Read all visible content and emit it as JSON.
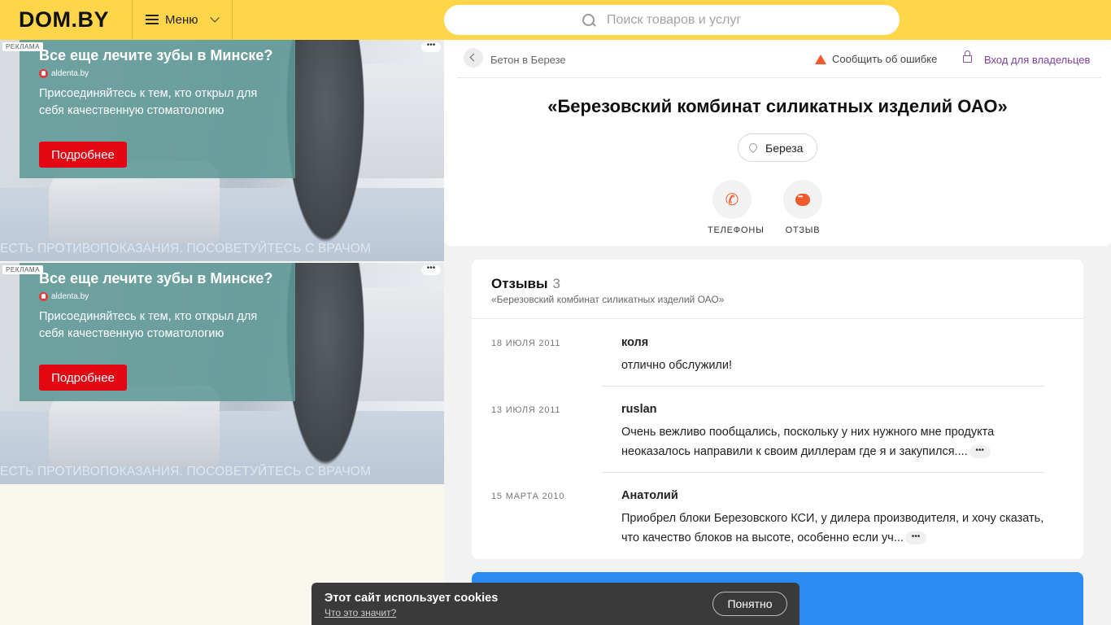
{
  "header": {
    "logo": "DOM.BY",
    "menu_label": "Меню",
    "search_placeholder": "Поиск товаров и услуг"
  },
  "ads": [
    {
      "badge": "РЕКЛАМА",
      "headline": "Все еще лечите зубы в Минске?",
      "site": "aldenta.by",
      "text": "Присоединяйтесь к тем, кто открыл для себя качественную стоматологию",
      "cta": "Подробнее",
      "disclaimer": "ЕСТЬ ПРОТИВОПОКАЗАНИЯ. ПОСОВЕТУЙТЕСЬ С ВРАЧОМ"
    },
    {
      "badge": "РЕКЛАМА",
      "headline": "Все еще лечите зубы в Минске?",
      "site": "aldenta.by",
      "text": "Присоединяйтесь к тем, кто открыл для себя качественную стоматологию",
      "cta": "Подробнее",
      "disclaimer": "ЕСТЬ ПРОТИВОПОКАЗАНИЯ. ПОСОВЕТУЙТЕСЬ С ВРАЧОМ"
    }
  ],
  "company": {
    "breadcrumb": "Бетон в Березе",
    "report_error": "Сообщить об ошибке",
    "owner_login": "Вход для владельцев",
    "title": "«Березовский комбинат силикатных изделий ОАО»",
    "city": "Береза",
    "actions": {
      "phones": "ТЕЛЕФОНЫ",
      "review": "ОТЗЫВ"
    }
  },
  "reviews": {
    "title": "Отзывы",
    "count": "3",
    "subtitle": "«Березовский комбинат силикатных изделий ОАО»",
    "items": [
      {
        "date": "18 ИЮЛЯ 2011",
        "author": "коля",
        "text": "отлично обслужили!"
      },
      {
        "date": "13 ИЮЛЯ 2011",
        "author": "ruslan",
        "text": "Очень вежливо пообщались, поскольку у них нужного мне продукта неоказалось направили к своим диллерам где я и закупился...."
      },
      {
        "date": "15 МАРТА 2010",
        "author": "Анатолий",
        "text": "Приобрел блоки Березовского КСИ, у дилера производителя, и хочу сказать, что качество блоков на высоте, особенно если уч..."
      }
    ]
  },
  "cookie": {
    "title": "Этот сайт использует cookies",
    "link": "Что это значит?",
    "button": "Понятно"
  },
  "colors": {
    "header_bg": "#ffd54a",
    "accent_orange": "#f0592a",
    "link_purple": "#7b3fa0",
    "ad_cta_red": "#e30613",
    "blue_block": "#2a8cf0"
  }
}
